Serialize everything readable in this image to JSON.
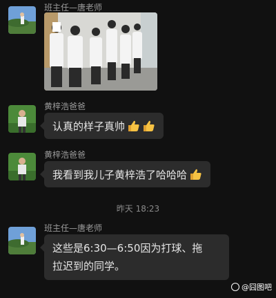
{
  "messages": [
    {
      "sender": "班主任—唐老师",
      "type": "image",
      "avatar_icon": "landscape-avatar-icon"
    },
    {
      "sender": "黄梓浩爸爸",
      "type": "text",
      "text": "认真的样子真帅",
      "emoji": [
        "thumbs-up-icon",
        "thumbs-up-icon"
      ],
      "avatar_icon": "man-avatar-icon"
    },
    {
      "sender": "黄梓浩爸爸",
      "type": "text",
      "text": "我看到我儿子黄梓浩了哈哈哈",
      "emoji": [
        "thumbs-up-icon"
      ],
      "avatar_icon": "man-avatar-icon"
    },
    {
      "sender": "班主任—唐老师",
      "type": "text",
      "lines": [
        "这些是6:30—6:50因为打球、拖",
        "拉迟到的同学。"
      ],
      "avatar_icon": "landscape-avatar-icon"
    }
  ],
  "timestamp": "昨天 18:23",
  "watermark": "@囧图吧",
  "colors": {
    "background": "#111111",
    "bubble": "#2c2c2c",
    "text": "#e6e6e6",
    "sender": "#9a9a9a"
  }
}
